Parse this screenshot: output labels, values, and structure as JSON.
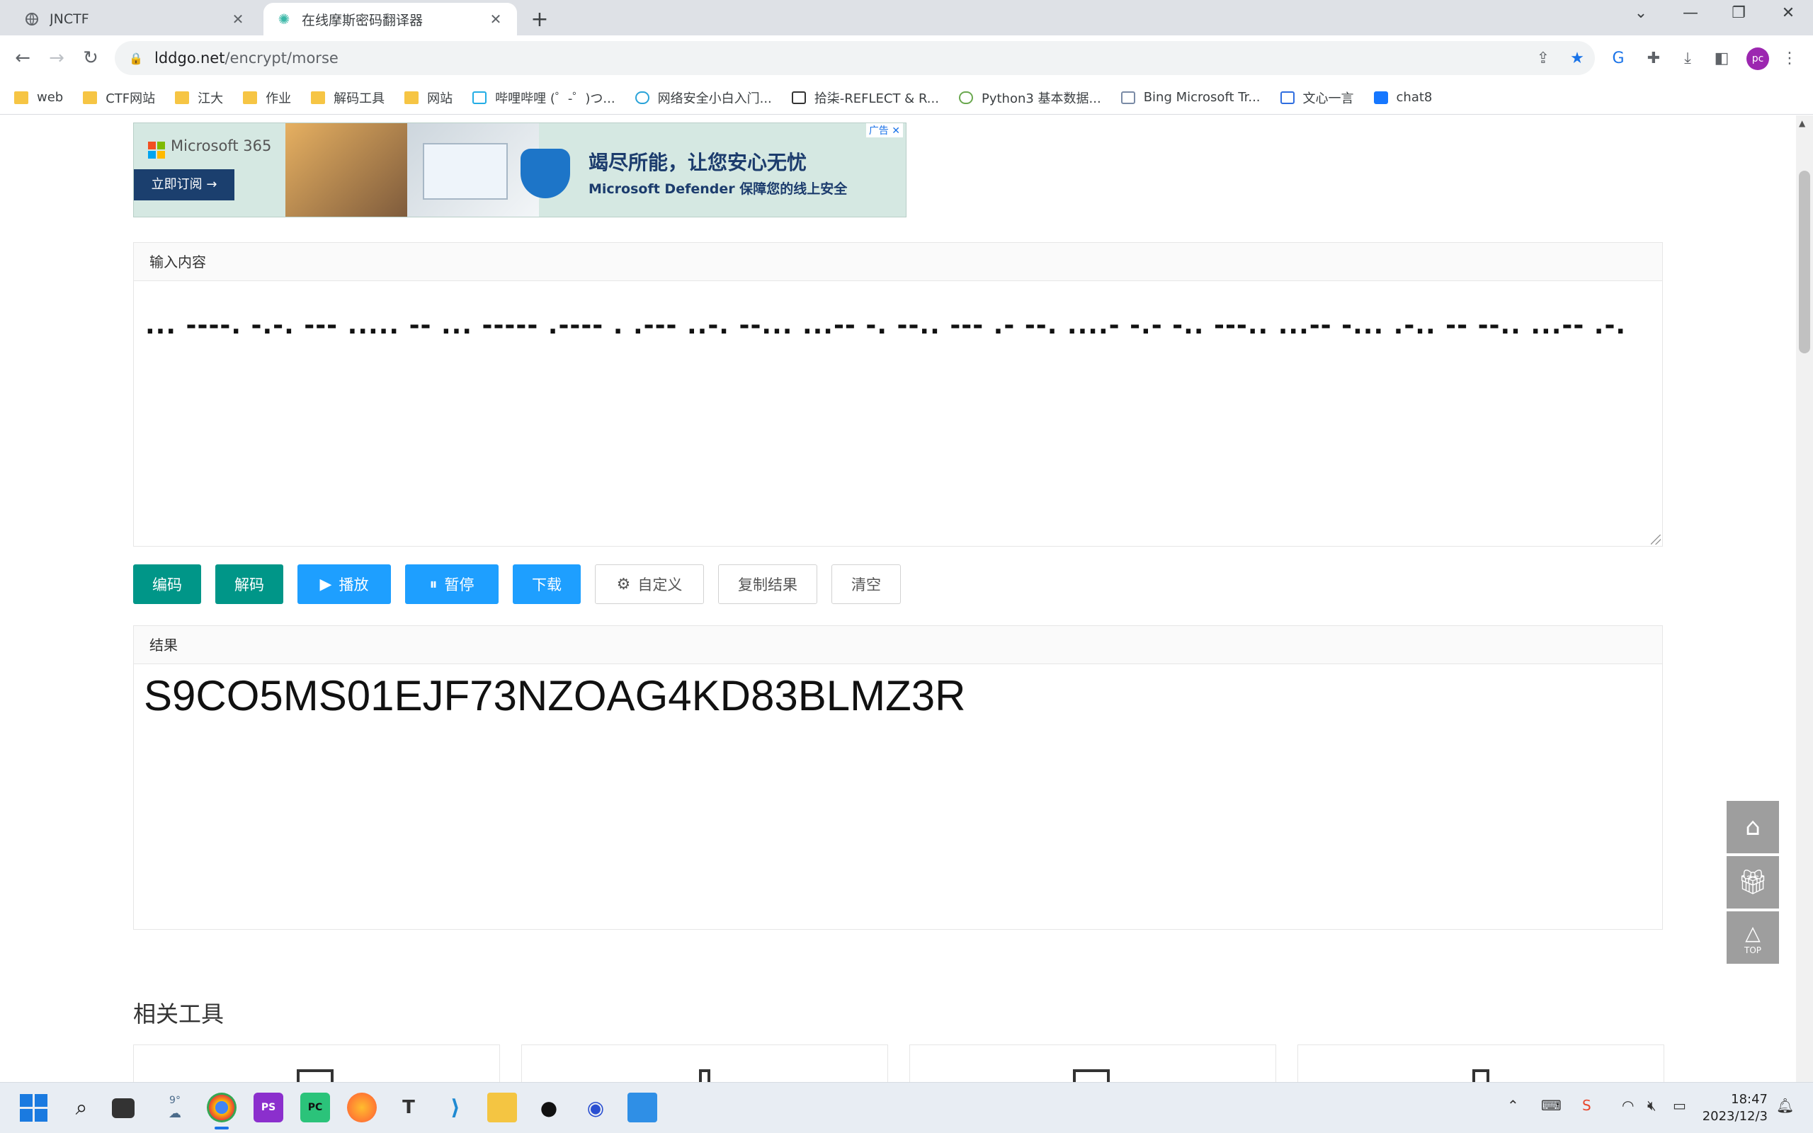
{
  "browser": {
    "tabs": [
      {
        "title": "JNCTF",
        "active": false
      },
      {
        "title": "在线摩斯密码翻译器",
        "active": true
      }
    ],
    "url_host": "lddgo.net",
    "url_path": "/encrypt/morse",
    "profile_initials": "pc",
    "bookmarks": [
      {
        "label": "web",
        "icon": "folder"
      },
      {
        "label": "CTF网站",
        "icon": "folder"
      },
      {
        "label": "江大",
        "icon": "folder"
      },
      {
        "label": "作业",
        "icon": "folder"
      },
      {
        "label": "解码工具",
        "icon": "folder"
      },
      {
        "label": "网站",
        "icon": "folder"
      },
      {
        "label": "哔哩哔哩 (゜-゜)つ...",
        "icon": "bilibili"
      },
      {
        "label": "网络安全小白入门...",
        "icon": "cloud"
      },
      {
        "label": "拾柒-REFLECT & R...",
        "icon": "site"
      },
      {
        "label": "Python3 基本数据...",
        "icon": "site"
      },
      {
        "label": "Bing Microsoft Tr...",
        "icon": "site"
      },
      {
        "label": "文心一言",
        "icon": "site"
      },
      {
        "label": "chat8",
        "icon": "site"
      }
    ]
  },
  "ad": {
    "brand": "Microsoft 365",
    "cta": "立即订阅 →",
    "headline": "竭尽所能，让您安心无忧",
    "subline": "Microsoft Defender 保障您的线上安全",
    "tag": "广告 ✕"
  },
  "input": {
    "label": "输入内容",
    "value": "... ----. -.-. --- ..... -- ... ----- .---- . .--- ..-. --... ...-- -. --.. --- .- --. ....- -.- -.. ---.. ...-- -... .-.. -- --.. ...-- .-."
  },
  "buttons": {
    "encode": "编码",
    "decode": "解码",
    "play": "播放",
    "pause": "暂停",
    "download": "下载",
    "custom": "自定义",
    "copy": "复制结果",
    "clear": "清空"
  },
  "result": {
    "label": "结果",
    "value": "S9CO5MS01EJF73NZOAG4KD83BLMZ3R"
  },
  "related": {
    "title": "相关工具"
  },
  "floating": {
    "top_label": "TOP"
  },
  "taskbar": {
    "weather": "9°",
    "time": "18:47",
    "date": "2023/12/3"
  }
}
